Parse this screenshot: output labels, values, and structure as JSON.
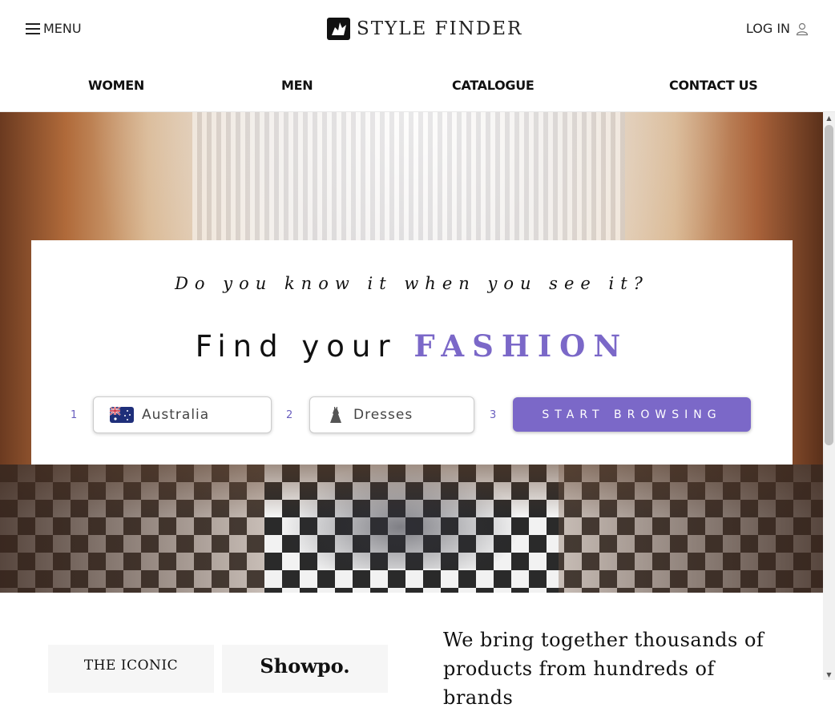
{
  "header": {
    "menu_label": "MENU",
    "logo_text": "STYLE FINDER",
    "login_label": "LOG IN"
  },
  "nav": {
    "items": [
      {
        "label": "WOMEN"
      },
      {
        "label": "MEN"
      },
      {
        "label": "CATALOGUE"
      },
      {
        "label": "CONTACT US"
      }
    ]
  },
  "hero": {
    "tagline": "Do you know it when you see it?",
    "headline_plain": "Find your",
    "headline_accent": "FASHION",
    "steps": [
      "1",
      "2",
      "3"
    ],
    "country_select": {
      "value": "Australia",
      "icon": "australia-flag-icon"
    },
    "category_select": {
      "value": "Dresses",
      "icon": "dress-icon"
    },
    "start_button_label": "START BROWSING"
  },
  "brands": [
    {
      "name": "THE ICONIC"
    },
    {
      "name": "Showpo."
    }
  ],
  "blurb": "We bring together thousands of products from hundreds of brands",
  "colors": {
    "accent": "#7b68c8",
    "text": "#111111"
  }
}
